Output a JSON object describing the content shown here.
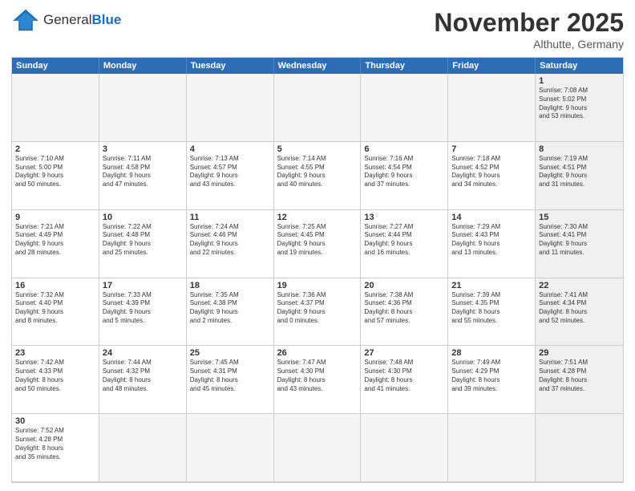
{
  "header": {
    "logo_general": "General",
    "logo_blue": "Blue",
    "month_title": "November 2025",
    "location": "Althutte, Germany"
  },
  "weekdays": [
    "Sunday",
    "Monday",
    "Tuesday",
    "Wednesday",
    "Thursday",
    "Friday",
    "Saturday"
  ],
  "cells": [
    {
      "day": "",
      "info": "",
      "empty": true
    },
    {
      "day": "",
      "info": "",
      "empty": true
    },
    {
      "day": "",
      "info": "",
      "empty": true
    },
    {
      "day": "",
      "info": "",
      "empty": true
    },
    {
      "day": "",
      "info": "",
      "empty": true
    },
    {
      "day": "",
      "info": "",
      "empty": true
    },
    {
      "day": "1",
      "info": "Sunrise: 7:08 AM\nSunset: 5:02 PM\nDaylight: 9 hours\nand 53 minutes.",
      "shaded": true
    },
    {
      "day": "2",
      "info": "Sunrise: 7:10 AM\nSunset: 5:00 PM\nDaylight: 9 hours\nand 50 minutes."
    },
    {
      "day": "3",
      "info": "Sunrise: 7:11 AM\nSunset: 4:58 PM\nDaylight: 9 hours\nand 47 minutes."
    },
    {
      "day": "4",
      "info": "Sunrise: 7:13 AM\nSunset: 4:57 PM\nDaylight: 9 hours\nand 43 minutes."
    },
    {
      "day": "5",
      "info": "Sunrise: 7:14 AM\nSunset: 4:55 PM\nDaylight: 9 hours\nand 40 minutes."
    },
    {
      "day": "6",
      "info": "Sunrise: 7:16 AM\nSunset: 4:54 PM\nDaylight: 9 hours\nand 37 minutes."
    },
    {
      "day": "7",
      "info": "Sunrise: 7:18 AM\nSunset: 4:52 PM\nDaylight: 9 hours\nand 34 minutes."
    },
    {
      "day": "8",
      "info": "Sunrise: 7:19 AM\nSunset: 4:51 PM\nDaylight: 9 hours\nand 31 minutes.",
      "shaded": true
    },
    {
      "day": "9",
      "info": "Sunrise: 7:21 AM\nSunset: 4:49 PM\nDaylight: 9 hours\nand 28 minutes."
    },
    {
      "day": "10",
      "info": "Sunrise: 7:22 AM\nSunset: 4:48 PM\nDaylight: 9 hours\nand 25 minutes."
    },
    {
      "day": "11",
      "info": "Sunrise: 7:24 AM\nSunset: 4:46 PM\nDaylight: 9 hours\nand 22 minutes."
    },
    {
      "day": "12",
      "info": "Sunrise: 7:25 AM\nSunset: 4:45 PM\nDaylight: 9 hours\nand 19 minutes."
    },
    {
      "day": "13",
      "info": "Sunrise: 7:27 AM\nSunset: 4:44 PM\nDaylight: 9 hours\nand 16 minutes."
    },
    {
      "day": "14",
      "info": "Sunrise: 7:29 AM\nSunset: 4:43 PM\nDaylight: 9 hours\nand 13 minutes."
    },
    {
      "day": "15",
      "info": "Sunrise: 7:30 AM\nSunset: 4:41 PM\nDaylight: 9 hours\nand 11 minutes.",
      "shaded": true
    },
    {
      "day": "16",
      "info": "Sunrise: 7:32 AM\nSunset: 4:40 PM\nDaylight: 9 hours\nand 8 minutes."
    },
    {
      "day": "17",
      "info": "Sunrise: 7:33 AM\nSunset: 4:39 PM\nDaylight: 9 hours\nand 5 minutes."
    },
    {
      "day": "18",
      "info": "Sunrise: 7:35 AM\nSunset: 4:38 PM\nDaylight: 9 hours\nand 2 minutes."
    },
    {
      "day": "19",
      "info": "Sunrise: 7:36 AM\nSunset: 4:37 PM\nDaylight: 9 hours\nand 0 minutes."
    },
    {
      "day": "20",
      "info": "Sunrise: 7:38 AM\nSunset: 4:36 PM\nDaylight: 8 hours\nand 57 minutes."
    },
    {
      "day": "21",
      "info": "Sunrise: 7:39 AM\nSunset: 4:35 PM\nDaylight: 8 hours\nand 55 minutes."
    },
    {
      "day": "22",
      "info": "Sunrise: 7:41 AM\nSunset: 4:34 PM\nDaylight: 8 hours\nand 52 minutes.",
      "shaded": true
    },
    {
      "day": "23",
      "info": "Sunrise: 7:42 AM\nSunset: 4:33 PM\nDaylight: 8 hours\nand 50 minutes."
    },
    {
      "day": "24",
      "info": "Sunrise: 7:44 AM\nSunset: 4:32 PM\nDaylight: 8 hours\nand 48 minutes."
    },
    {
      "day": "25",
      "info": "Sunrise: 7:45 AM\nSunset: 4:31 PM\nDaylight: 8 hours\nand 45 minutes."
    },
    {
      "day": "26",
      "info": "Sunrise: 7:47 AM\nSunset: 4:30 PM\nDaylight: 8 hours\nand 43 minutes."
    },
    {
      "day": "27",
      "info": "Sunrise: 7:48 AM\nSunset: 4:30 PM\nDaylight: 8 hours\nand 41 minutes."
    },
    {
      "day": "28",
      "info": "Sunrise: 7:49 AM\nSunset: 4:29 PM\nDaylight: 8 hours\nand 39 minutes."
    },
    {
      "day": "29",
      "info": "Sunrise: 7:51 AM\nSunset: 4:28 PM\nDaylight: 8 hours\nand 37 minutes.",
      "shaded": true
    },
    {
      "day": "30",
      "info": "Sunrise: 7:52 AM\nSunset: 4:28 PM\nDaylight: 8 hours\nand 35 minutes."
    },
    {
      "day": "",
      "info": "",
      "empty": true
    },
    {
      "day": "",
      "info": "",
      "empty": true
    },
    {
      "day": "",
      "info": "",
      "empty": true
    },
    {
      "day": "",
      "info": "",
      "empty": true
    },
    {
      "day": "",
      "info": "",
      "empty": true
    },
    {
      "day": "",
      "info": "",
      "empty": true,
      "shaded": true
    }
  ]
}
